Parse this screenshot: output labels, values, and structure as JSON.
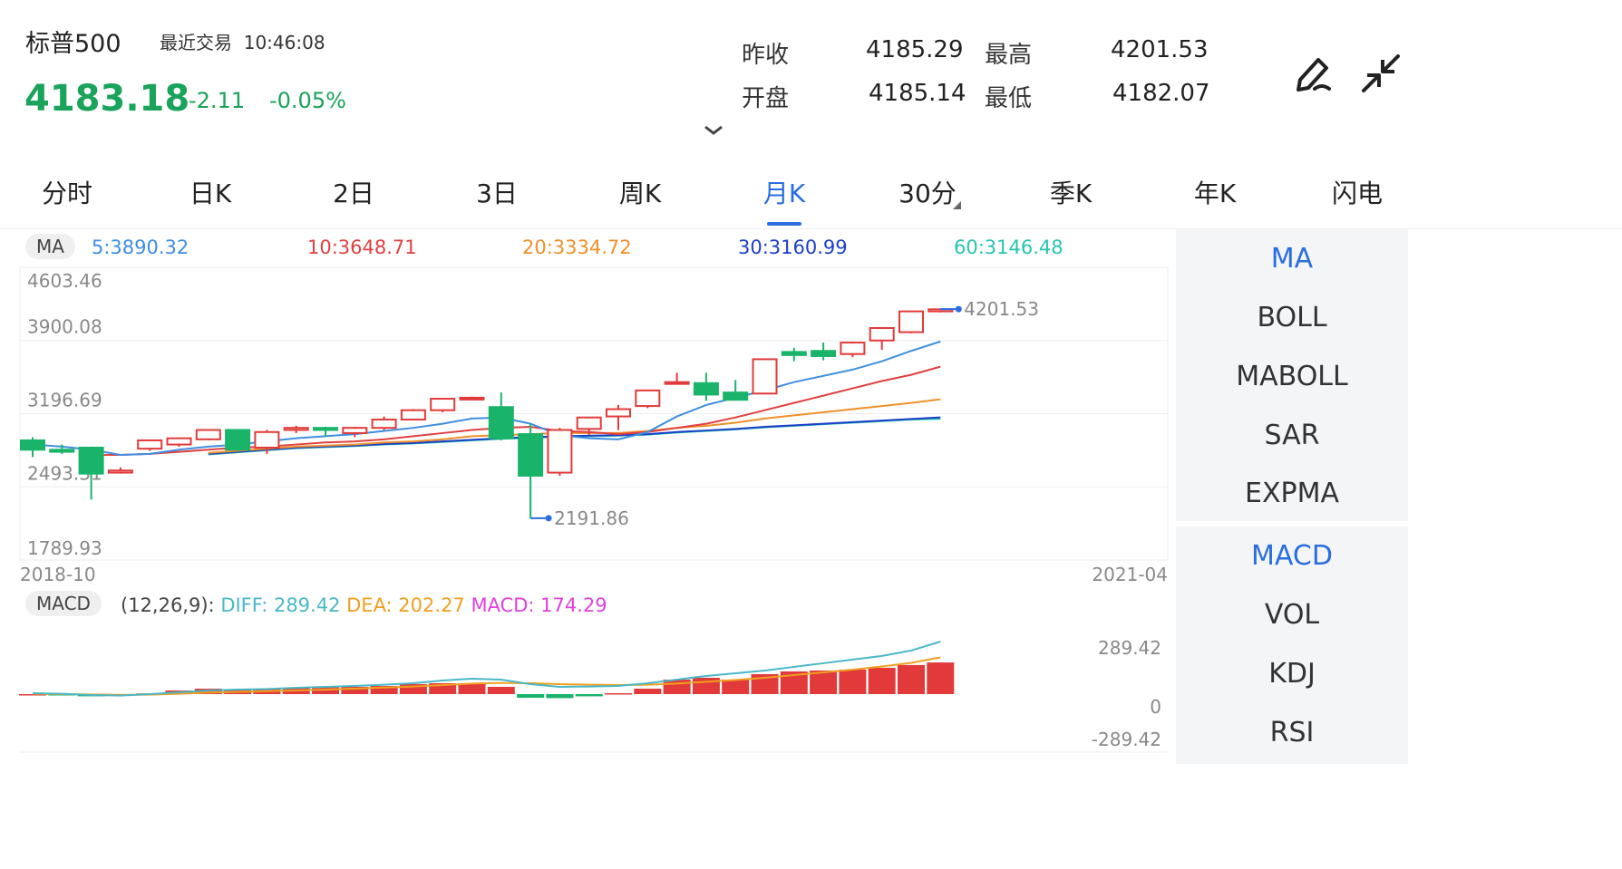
{
  "header": {
    "name": "标普500",
    "last_trade_label": "最近交易",
    "last_trade_time": "10:46:08",
    "price": "4183.18",
    "change": "-2.11",
    "change_pct": "-0.05%",
    "stats": [
      {
        "label": "昨收",
        "value": "4185.29"
      },
      {
        "label": "最高",
        "value": "4201.53"
      },
      {
        "label": "开盘",
        "value": "4185.14"
      },
      {
        "label": "最低",
        "value": "4182.07"
      }
    ]
  },
  "tabs": [
    "分时",
    "日K",
    "2日",
    "3日",
    "周K",
    "月K",
    "30分",
    "季K",
    "年K",
    "闪电"
  ],
  "active_tab": "月K",
  "side_menu_main": [
    "MA",
    "BOLL",
    "MABOLL",
    "SAR",
    "EXPMA"
  ],
  "side_menu_sub": [
    "MACD",
    "VOL",
    "KDJ",
    "RSI"
  ],
  "colors": {
    "up": "#e23a3a",
    "down": "#19b46a",
    "accent": "#2a6de0",
    "ma5": "#3e8ee0",
    "ma10": "#e04040",
    "ma20": "#f0902a",
    "ma30": "#1d3fc8",
    "ma60": "#27c4ae",
    "diff": "#4ab8c8",
    "dea": "#f0a020",
    "macd": "#e040e0"
  },
  "icons": {
    "edit": "edit-pen-icon",
    "collapse": "shrink-arrows-icon",
    "more": "chevron-down-icon"
  },
  "chart_data": [
    {
      "type": "candlestick",
      "legend_badge": "MA",
      "legend": [
        {
          "label": "5:3890.32",
          "color": "#3e8ee0"
        },
        {
          "label": "10:3648.71",
          "color": "#e04040"
        },
        {
          "label": "20:3334.72",
          "color": "#f0902a"
        },
        {
          "label": "30:3160.99",
          "color": "#1d3fc8"
        },
        {
          "label": "60:3146.48",
          "color": "#27c4ae"
        }
      ],
      "y_ticks": [
        "4603.46",
        "3900.08",
        "3196.69",
        "2493.31",
        "1789.93"
      ],
      "ylim": [
        1789.93,
        4603.46
      ],
      "x_range_labels": [
        "2018-10",
        "2021-04"
      ],
      "max_label": "4201.53",
      "min_label": "2191.86",
      "grid": true,
      "candles": [
        {
          "o": 2940,
          "h": 2970,
          "l": 2780,
          "c": 2850
        },
        {
          "o": 2850,
          "h": 2900,
          "l": 2810,
          "c": 2830
        },
        {
          "o": 2870,
          "h": 2880,
          "l": 2370,
          "c": 2620
        },
        {
          "o": 2630,
          "h": 2680,
          "l": 2620,
          "c": 2650
        },
        {
          "o": 2860,
          "h": 2940,
          "l": 2840,
          "c": 2940
        },
        {
          "o": 2900,
          "h": 2960,
          "l": 2880,
          "c": 2960
        },
        {
          "o": 2950,
          "h": 3040,
          "l": 2940,
          "c": 3040
        },
        {
          "o": 3040,
          "h": 3040,
          "l": 2840,
          "c": 2850
        },
        {
          "o": 2870,
          "h": 3040,
          "l": 2810,
          "c": 3020
        },
        {
          "o": 3040,
          "h": 3080,
          "l": 3010,
          "c": 3060
        },
        {
          "o": 3060,
          "h": 3070,
          "l": 2980,
          "c": 3040
        },
        {
          "o": 3010,
          "h": 3070,
          "l": 2970,
          "c": 3060
        },
        {
          "o": 3060,
          "h": 3170,
          "l": 3040,
          "c": 3140
        },
        {
          "o": 3140,
          "h": 3240,
          "l": 3140,
          "c": 3230
        },
        {
          "o": 3230,
          "h": 3340,
          "l": 3210,
          "c": 3340
        },
        {
          "o": 3350,
          "h": 3360,
          "l": 3330,
          "c": 3350
        },
        {
          "o": 3260,
          "h": 3400,
          "l": 2940,
          "c": 2960
        },
        {
          "o": 3000,
          "h": 3100,
          "l": 2191.86,
          "c": 2600
        },
        {
          "o": 2630,
          "h": 3060,
          "l": 2600,
          "c": 3040
        },
        {
          "o": 3050,
          "h": 3160,
          "l": 2990,
          "c": 3160
        },
        {
          "o": 3170,
          "h": 3280,
          "l": 3040,
          "c": 3240
        },
        {
          "o": 3270,
          "h": 3420,
          "l": 3250,
          "c": 3420
        },
        {
          "o": 3500,
          "h": 3590,
          "l": 3480,
          "c": 3500
        },
        {
          "o": 3490,
          "h": 3590,
          "l": 3320,
          "c": 3380
        },
        {
          "o": 3400,
          "h": 3520,
          "l": 3360,
          "c": 3330
        },
        {
          "o": 3390,
          "h": 3720,
          "l": 3390,
          "c": 3720
        },
        {
          "o": 3790,
          "h": 3830,
          "l": 3700,
          "c": 3760
        },
        {
          "o": 3800,
          "h": 3880,
          "l": 3710,
          "c": 3750
        },
        {
          "o": 3770,
          "h": 3890,
          "l": 3740,
          "c": 3880
        },
        {
          "o": 3900,
          "h": 4020,
          "l": 3810,
          "c": 4020
        },
        {
          "o": 3980,
          "h": 4180,
          "l": 3970,
          "c": 4180
        },
        {
          "o": 4180,
          "h": 4201.53,
          "l": 4170,
          "c": 4200
        }
      ],
      "ma5": [
        2900,
        2880,
        2850,
        2800,
        2810,
        2850,
        2880,
        2900,
        2930,
        2960,
        2980,
        3000,
        3030,
        3060,
        3100,
        3150,
        3160,
        3100,
        2990,
        2960,
        2950,
        3020,
        3170,
        3280,
        3350,
        3420,
        3500,
        3560,
        3620,
        3700,
        3800,
        3890.32
      ],
      "ma10": [
        null,
        null,
        2800,
        2800,
        2810,
        2830,
        2850,
        2870,
        2880,
        2900,
        2920,
        2930,
        2950,
        2980,
        3010,
        3040,
        3060,
        3070,
        3030,
        3020,
        3000,
        3020,
        3060,
        3100,
        3160,
        3230,
        3300,
        3370,
        3440,
        3510,
        3570,
        3648.71
      ],
      "ma20": [
        null,
        null,
        null,
        null,
        null,
        null,
        2820,
        2840,
        2860,
        2880,
        2890,
        2900,
        2920,
        2930,
        2950,
        2980,
        2990,
        3000,
        3010,
        3010,
        3010,
        3030,
        3060,
        3080,
        3110,
        3150,
        3180,
        3210,
        3240,
        3270,
        3300,
        3334.72
      ],
      "ma30": [
        null,
        null,
        null,
        null,
        null,
        null,
        2810,
        2830,
        2850,
        2870,
        2880,
        2890,
        2905,
        2915,
        2930,
        2945,
        2960,
        2970,
        2980,
        2985,
        2990,
        3000,
        3020,
        3035,
        3050,
        3070,
        3085,
        3100,
        3115,
        3130,
        3145,
        3160.99
      ],
      "ma60": [
        null,
        null,
        null,
        null,
        null,
        null,
        2805,
        2825,
        2845,
        2865,
        2875,
        2885,
        2900,
        2910,
        2925,
        2940,
        2955,
        2965,
        2975,
        2980,
        2985,
        2995,
        3015,
        3030,
        3045,
        3065,
        3080,
        3095,
        3110,
        3125,
        3140,
        3146.48
      ]
    },
    {
      "type": "bar",
      "legend_badge": "MACD",
      "params": "(12,26,9):",
      "legend": [
        {
          "label": "DIFF: 289.42",
          "color": "#4ab8c8"
        },
        {
          "label": "DEA: 202.27",
          "color": "#f0a020"
        },
        {
          "label": "MACD: 174.29",
          "color": "#e040e0"
        }
      ],
      "y_ticks": [
        "289.42",
        "0",
        "-289.42"
      ],
      "ylim": [
        -289.42,
        289.42
      ],
      "macd": [
        0,
        -5,
        -12,
        -5,
        4,
        20,
        30,
        25,
        28,
        35,
        40,
        40,
        45,
        55,
        60,
        60,
        40,
        -20,
        -22,
        -12,
        5,
        30,
        80,
        90,
        80,
        110,
        125,
        130,
        135,
        145,
        160,
        174.29
      ],
      "diff": [
        5,
        2,
        -5,
        -8,
        0,
        10,
        20,
        25,
        28,
        35,
        40,
        45,
        52,
        60,
        75,
        85,
        80,
        55,
        40,
        42,
        45,
        60,
        80,
        100,
        115,
        130,
        150,
        170,
        190,
        210,
        240,
        289.42
      ],
      "dea": [
        2,
        0,
        -2,
        -4,
        -3,
        2,
        8,
        12,
        16,
        20,
        25,
        30,
        36,
        42,
        50,
        58,
        62,
        60,
        55,
        52,
        50,
        52,
        58,
        68,
        78,
        90,
        105,
        120,
        135,
        152,
        172,
        202.27
      ]
    }
  ]
}
